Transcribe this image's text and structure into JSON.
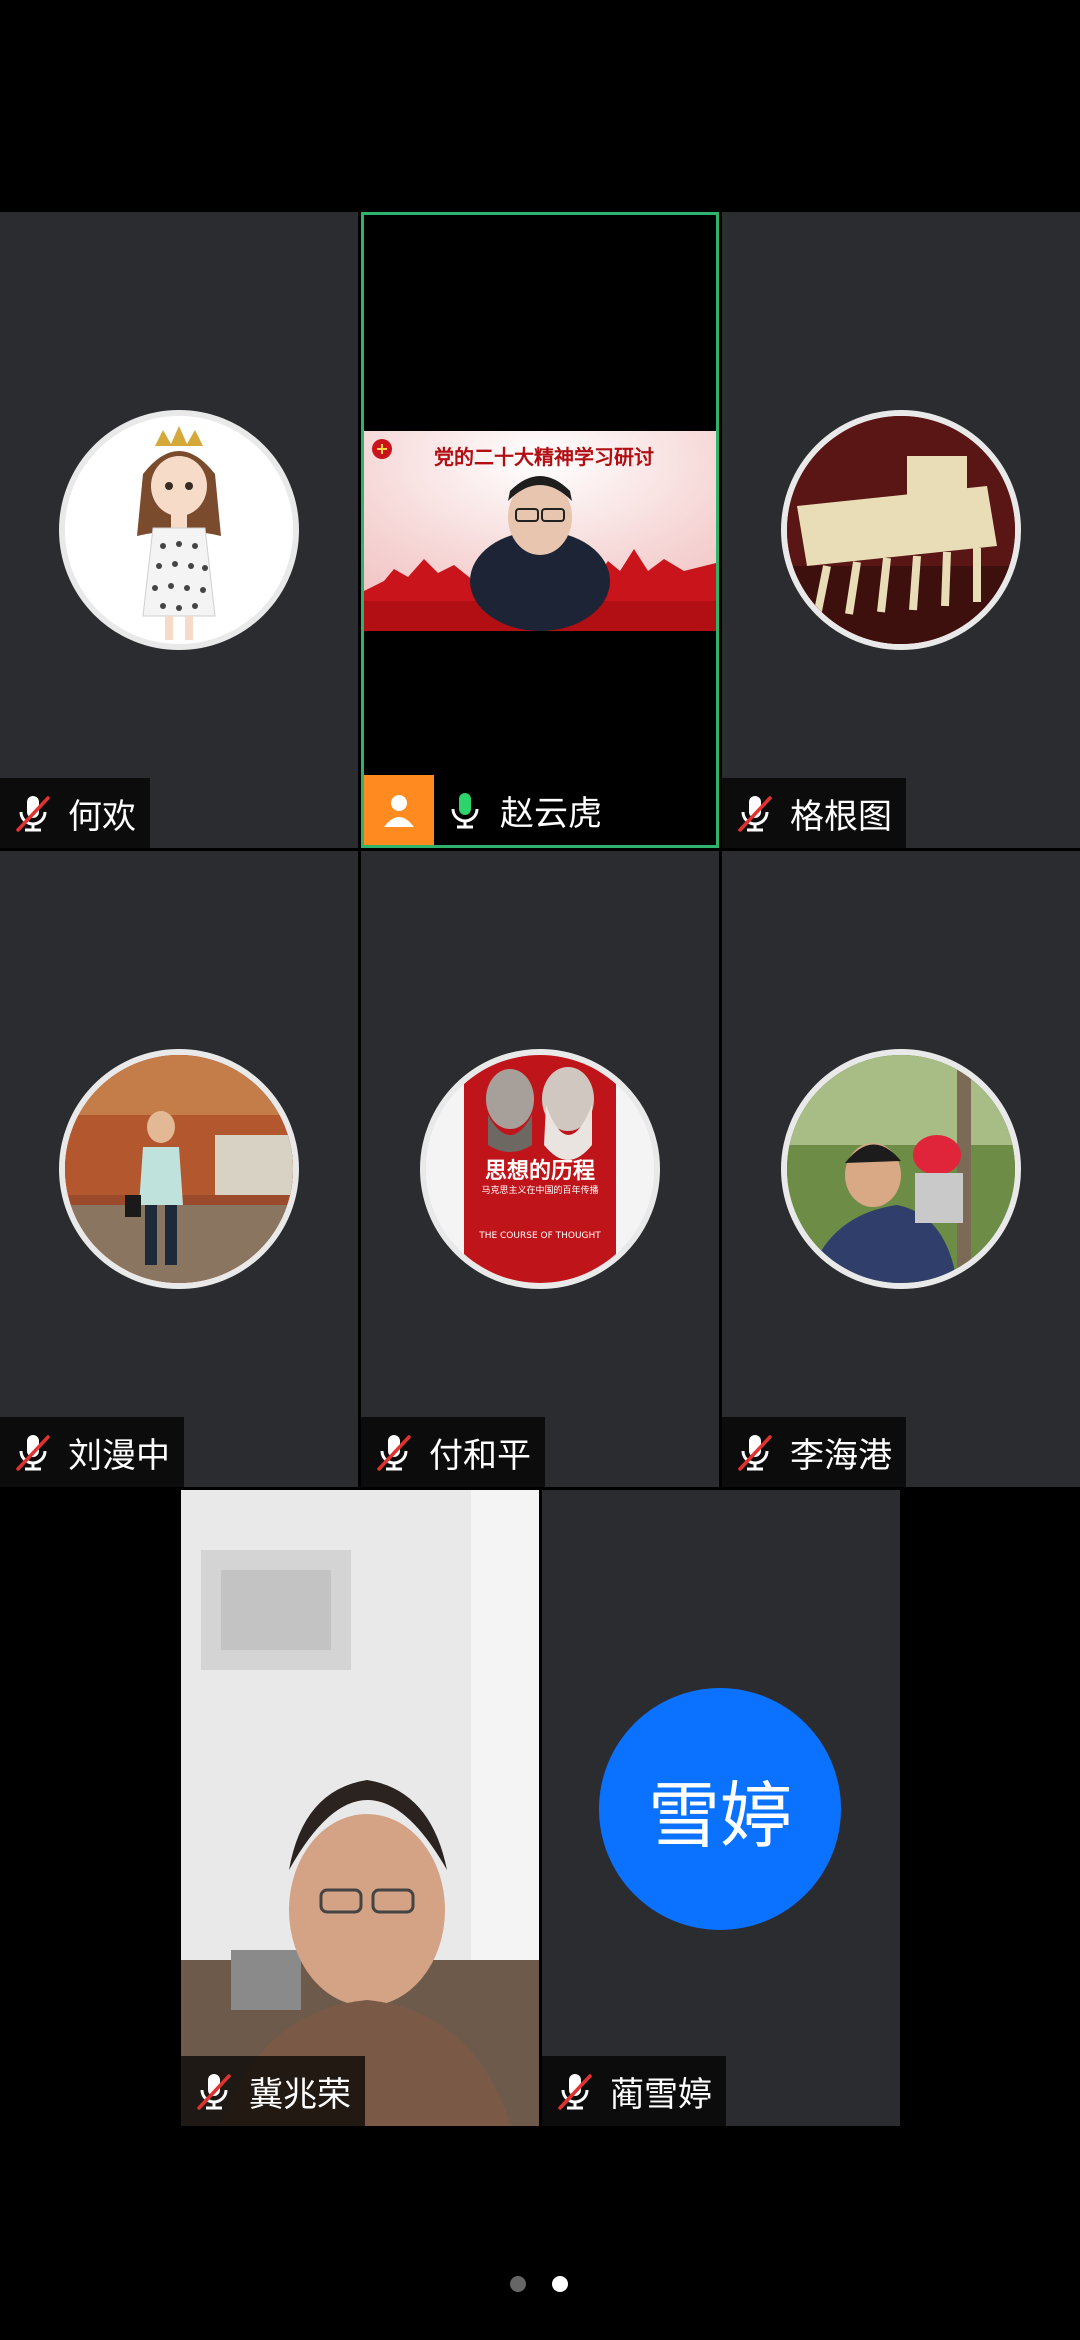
{
  "participants": [
    {
      "name": "何欢",
      "muted": true
    },
    {
      "name": "赵云虎",
      "muted": false,
      "speaking": true
    },
    {
      "name": "格根图",
      "muted": true
    },
    {
      "name": "刘漫中",
      "muted": true
    },
    {
      "name": "付和平",
      "muted": true
    },
    {
      "name": "李海港",
      "muted": true
    },
    {
      "name": "冀兆荣",
      "muted": true
    },
    {
      "name": "蔺雪婷",
      "muted": true
    }
  ],
  "shared_slide": {
    "title": "党的二十大精神学习研讨"
  },
  "book_cover": {
    "title": "思想的历程",
    "subtitle": "马克思主义在中国的百年传播",
    "english": "THE COURSE OF THOUGHT"
  },
  "initials_avatar": {
    "text": "雪婷",
    "color": "#0a72ff"
  },
  "colors": {
    "active_border": "#2fb36b",
    "tile_bg": "#2b2c30",
    "mute_red": "#e0332f",
    "mic_green": "#2fd36b",
    "host_badge": "#ff8a1f"
  },
  "pagination": {
    "pages": 2,
    "current": 2
  }
}
